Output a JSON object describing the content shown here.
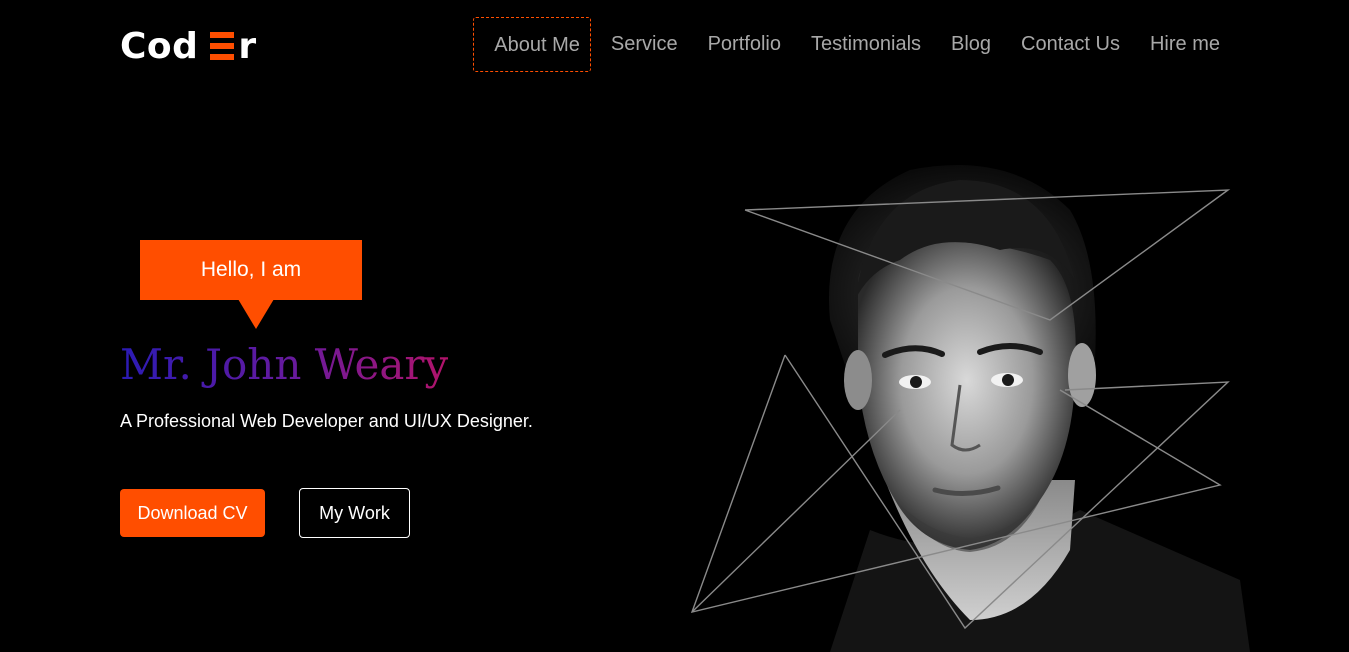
{
  "logo": {
    "text_left": "Cod",
    "text_right": "r"
  },
  "nav": {
    "items": [
      {
        "label": "About Me",
        "active": true
      },
      {
        "label": "Service",
        "active": false
      },
      {
        "label": "Portfolio",
        "active": false
      },
      {
        "label": "Testimonials",
        "active": false
      },
      {
        "label": "Blog",
        "active": false
      },
      {
        "label": "Contact Us",
        "active": false
      },
      {
        "label": "Hire me",
        "active": false
      }
    ]
  },
  "hero": {
    "greeting": "Hello, I am",
    "name": "Mr. John Weary",
    "tagline": "A Professional Web Developer and UI/UX Designer.",
    "primary_button": "Download CV",
    "secondary_button": "My Work"
  },
  "colors": {
    "accent": "#ff4e00",
    "background": "#000000",
    "nav_text": "#a8a8a8",
    "name_gradient_start": "#2b1bb5",
    "name_gradient_end": "#b2136a"
  },
  "icons": {
    "logo_mark": "three-bar-e-icon"
  }
}
